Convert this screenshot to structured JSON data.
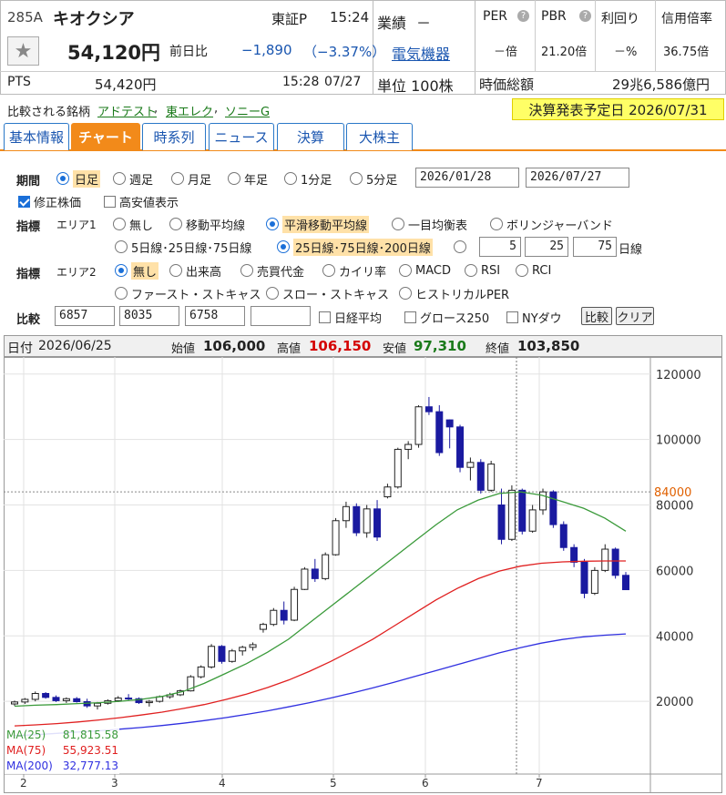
{
  "stock": {
    "code": "285A",
    "name": "キオクシア",
    "market": "東証P",
    "time": "15:24",
    "price": "54,120円",
    "change_label": "前日比",
    "change": "−1,890",
    "change_pct": "（−3.37%）",
    "pts_label": "PTS",
    "pts_price": "54,420円",
    "pts_time": "15:28",
    "pts_date": "07/27"
  },
  "results": {
    "label": "業績",
    "value": "－"
  },
  "industry": "電気機器",
  "unit": "単位 100株",
  "indicators": [
    {
      "label": "PER",
      "value": "－倍"
    },
    {
      "label": "PBR",
      "value": "21.20倍"
    },
    {
      "label": "利回り",
      "value": "－%"
    },
    {
      "label": "信用倍率",
      "value": "36.75倍"
    }
  ],
  "market_cap_label": "時価総額",
  "market_cap": "29兆6,586億円",
  "compare": {
    "label": "比較される銘柄",
    "items": [
      "アドテスト",
      "東エレク",
      "ソニーG"
    ]
  },
  "earnings": "決算発表予定日 2026/07/31",
  "tabs": [
    "基本情報",
    "チャート",
    "時系列",
    "ニュース",
    "決算",
    "大株主"
  ],
  "period": {
    "label": "期間",
    "options": [
      "日足",
      "週足",
      "月足",
      "年足",
      "1分足",
      "5分足"
    ],
    "selected": "日足",
    "from": "2026/01/28",
    "to": "2026/07/27"
  },
  "adjusted_label": "修正株価",
  "highlow_label": "高安値表示",
  "indicator1": {
    "label": "指標",
    "area": "エリア1",
    "options": [
      "無し",
      "移動平均線",
      "平滑移動平均線",
      "一目均衡表",
      "ボリンジャーバンド"
    ],
    "ma_opt1": "5日線･25日線･75日線",
    "ma_opt2": "25日線･75日線･200日線",
    "ma_vals": [
      "5",
      "25",
      "75"
    ],
    "ma_unit": "日線"
  },
  "indicator2": {
    "label": "指標",
    "area": "エリア2",
    "options": [
      "無し",
      "出来高",
      "売買代金",
      "カイリ率",
      "MACD",
      "RSI",
      "RCI"
    ],
    "options2": [
      "ファースト・ストキャス",
      "スロー・ストキャス",
      "ヒストリカルPER"
    ]
  },
  "comparison": {
    "label": "比較",
    "codes": [
      "6857",
      "8035",
      "6758",
      ""
    ],
    "checks": [
      "日経平均",
      "グロース250",
      "NYダウ"
    ],
    "compare_btn": "比較",
    "clear_btn": "クリア"
  },
  "ohlc": {
    "date_label": "日付",
    "date": "2026/06/25",
    "open_label": "始値",
    "open": "106,000",
    "high_label": "高値",
    "high": "106,150",
    "low_label": "安値",
    "low": "97,310",
    "close_label": "終値",
    "close": "103,850"
  },
  "chart_data": {
    "type": "candlestick",
    "y_ticks": [
      "120000",
      "100000",
      "80000",
      "60000",
      "40000",
      "20000"
    ],
    "y_range": [
      0,
      123000
    ],
    "ref_line": {
      "label": "84000",
      "value": 84000
    },
    "x_labels": [
      "2",
      "3",
      "4",
      "5",
      "6",
      "7"
    ],
    "ma_legend": [
      {
        "name": "MA(25)",
        "value": "81,815.58",
        "color": "#3a9a3a"
      },
      {
        "name": "MA(75)",
        "value": "55,923.51",
        "color": "#e02020"
      },
      {
        "name": "MA(200)",
        "value": "32,777.13",
        "color": "#3030e0"
      }
    ],
    "ma25": [
      18500,
      18800,
      19000,
      19300,
      19600,
      20000,
      20600,
      21500,
      23000,
      25500,
      28500,
      31500,
      35000,
      39000,
      44000,
      49000,
      54000,
      59000,
      64000,
      69000,
      74000,
      78500,
      81500,
      83500,
      84000,
      83000,
      81000,
      79000,
      76000,
      72000
    ],
    "ma75": [
      12500,
      12800,
      13200,
      13700,
      14300,
      15000,
      15800,
      16700,
      17800,
      19000,
      20500,
      22200,
      24200,
      26500,
      29200,
      32200,
      35500,
      39000,
      43000,
      47000,
      51000,
      54500,
      57500,
      59800,
      61300,
      62200,
      62600,
      62800,
      62900,
      62900
    ],
    "ma200": [
      9500,
      9800,
      10200,
      10600,
      11000,
      11500,
      12000,
      12600,
      13300,
      14100,
      15000,
      16000,
      17100,
      18300,
      19600,
      21000,
      22500,
      24100,
      25800,
      27600,
      29400,
      31200,
      33000,
      34800,
      36400,
      37800,
      38900,
      39700,
      40200,
      40600
    ],
    "candles": [
      {
        "o": 19200,
        "h": 20200,
        "l": 18600,
        "c": 19800
      },
      {
        "o": 19800,
        "h": 21000,
        "l": 19200,
        "c": 20600
      },
      {
        "o": 20600,
        "h": 23000,
        "l": 20000,
        "c": 22400
      },
      {
        "o": 22400,
        "h": 22800,
        "l": 20800,
        "c": 21200
      },
      {
        "o": 21200,
        "h": 21800,
        "l": 19800,
        "c": 20200
      },
      {
        "o": 20200,
        "h": 21200,
        "l": 19500,
        "c": 20800
      },
      {
        "o": 20800,
        "h": 21300,
        "l": 19600,
        "c": 19900
      },
      {
        "o": 19900,
        "h": 20800,
        "l": 18000,
        "c": 18600
      },
      {
        "o": 18600,
        "h": 19800,
        "l": 17500,
        "c": 19400
      },
      {
        "o": 19400,
        "h": 20600,
        "l": 19000,
        "c": 20200
      },
      {
        "o": 20200,
        "h": 21600,
        "l": 19800,
        "c": 21000
      },
      {
        "o": 21000,
        "h": 22200,
        "l": 20400,
        "c": 20800
      },
      {
        "o": 20800,
        "h": 21200,
        "l": 19200,
        "c": 19600
      },
      {
        "o": 19600,
        "h": 20400,
        "l": 18400,
        "c": 20000
      },
      {
        "o": 20000,
        "h": 21800,
        "l": 19600,
        "c": 21400
      },
      {
        "o": 21400,
        "h": 22600,
        "l": 20800,
        "c": 22000
      },
      {
        "o": 22000,
        "h": 23600,
        "l": 21600,
        "c": 23200
      },
      {
        "o": 23200,
        "h": 28000,
        "l": 23000,
        "c": 27500
      },
      {
        "o": 27500,
        "h": 31000,
        "l": 27000,
        "c": 30500
      },
      {
        "o": 30500,
        "h": 37500,
        "l": 30000,
        "c": 36800
      },
      {
        "o": 36800,
        "h": 37200,
        "l": 31500,
        "c": 32200
      },
      {
        "o": 32200,
        "h": 36000,
        "l": 31800,
        "c": 35400
      },
      {
        "o": 35400,
        "h": 37000,
        "l": 34000,
        "c": 36500
      },
      {
        "o": 36500,
        "h": 38000,
        "l": 35500,
        "c": 37300
      },
      {
        "o": 42000,
        "h": 44000,
        "l": 41000,
        "c": 43500
      },
      {
        "o": 43500,
        "h": 48500,
        "l": 43000,
        "c": 47800
      },
      {
        "o": 47800,
        "h": 50500,
        "l": 43500,
        "c": 44800
      },
      {
        "o": 44800,
        "h": 55000,
        "l": 44500,
        "c": 54200
      },
      {
        "o": 54200,
        "h": 61000,
        "l": 54000,
        "c": 60400
      },
      {
        "o": 60400,
        "h": 63500,
        "l": 56500,
        "c": 57500
      },
      {
        "o": 57500,
        "h": 65500,
        "l": 57000,
        "c": 64800
      },
      {
        "o": 64800,
        "h": 76000,
        "l": 64500,
        "c": 75200
      },
      {
        "o": 75200,
        "h": 81000,
        "l": 73000,
        "c": 79500
      },
      {
        "o": 79500,
        "h": 80500,
        "l": 70500,
        "c": 71500
      },
      {
        "o": 71500,
        "h": 80000,
        "l": 70000,
        "c": 78800
      },
      {
        "o": 78800,
        "h": 81500,
        "l": 69000,
        "c": 70200
      },
      {
        "o": 82500,
        "h": 86500,
        "l": 82000,
        "c": 85500
      },
      {
        "o": 85500,
        "h": 97500,
        "l": 85000,
        "c": 97000
      },
      {
        "o": 97000,
        "h": 99500,
        "l": 94000,
        "c": 98500
      },
      {
        "o": 98500,
        "h": 110500,
        "l": 97500,
        "c": 110000
      },
      {
        "o": 110000,
        "h": 113000,
        "l": 107500,
        "c": 108500
      },
      {
        "o": 108500,
        "h": 110500,
        "l": 95000,
        "c": 96000
      },
      {
        "o": 106000,
        "h": 106150,
        "l": 97310,
        "c": 103850
      },
      {
        "o": 103850,
        "h": 104500,
        "l": 90000,
        "c": 91500
      },
      {
        "o": 91500,
        "h": 94500,
        "l": 87500,
        "c": 93000
      },
      {
        "o": 93000,
        "h": 94000,
        "l": 83500,
        "c": 84500
      },
      {
        "o": 84500,
        "h": 93500,
        "l": 84000,
        "c": 92500
      },
      {
        "o": 80000,
        "h": 85000,
        "l": 68000,
        "c": 69500
      },
      {
        "o": 69500,
        "h": 86000,
        "l": 69000,
        "c": 84500
      },
      {
        "o": 84500,
        "h": 85000,
        "l": 71000,
        "c": 72000
      },
      {
        "o": 72000,
        "h": 80000,
        "l": 71500,
        "c": 78500
      },
      {
        "o": 78500,
        "h": 85000,
        "l": 77000,
        "c": 84000
      },
      {
        "o": 84000,
        "h": 84500,
        "l": 73000,
        "c": 74000
      },
      {
        "o": 74000,
        "h": 75000,
        "l": 66000,
        "c": 67000
      },
      {
        "o": 67000,
        "h": 68000,
        "l": 61000,
        "c": 62500
      },
      {
        "o": 62500,
        "h": 63500,
        "l": 51500,
        "c": 53000
      },
      {
        "o": 53000,
        "h": 61000,
        "l": 52500,
        "c": 60000
      },
      {
        "o": 60000,
        "h": 68000,
        "l": 59500,
        "c": 66500
      },
      {
        "o": 66500,
        "h": 67000,
        "l": 57500,
        "c": 58500
      },
      {
        "o": 58500,
        "h": 59500,
        "l": 54000,
        "c": 54120
      }
    ]
  }
}
